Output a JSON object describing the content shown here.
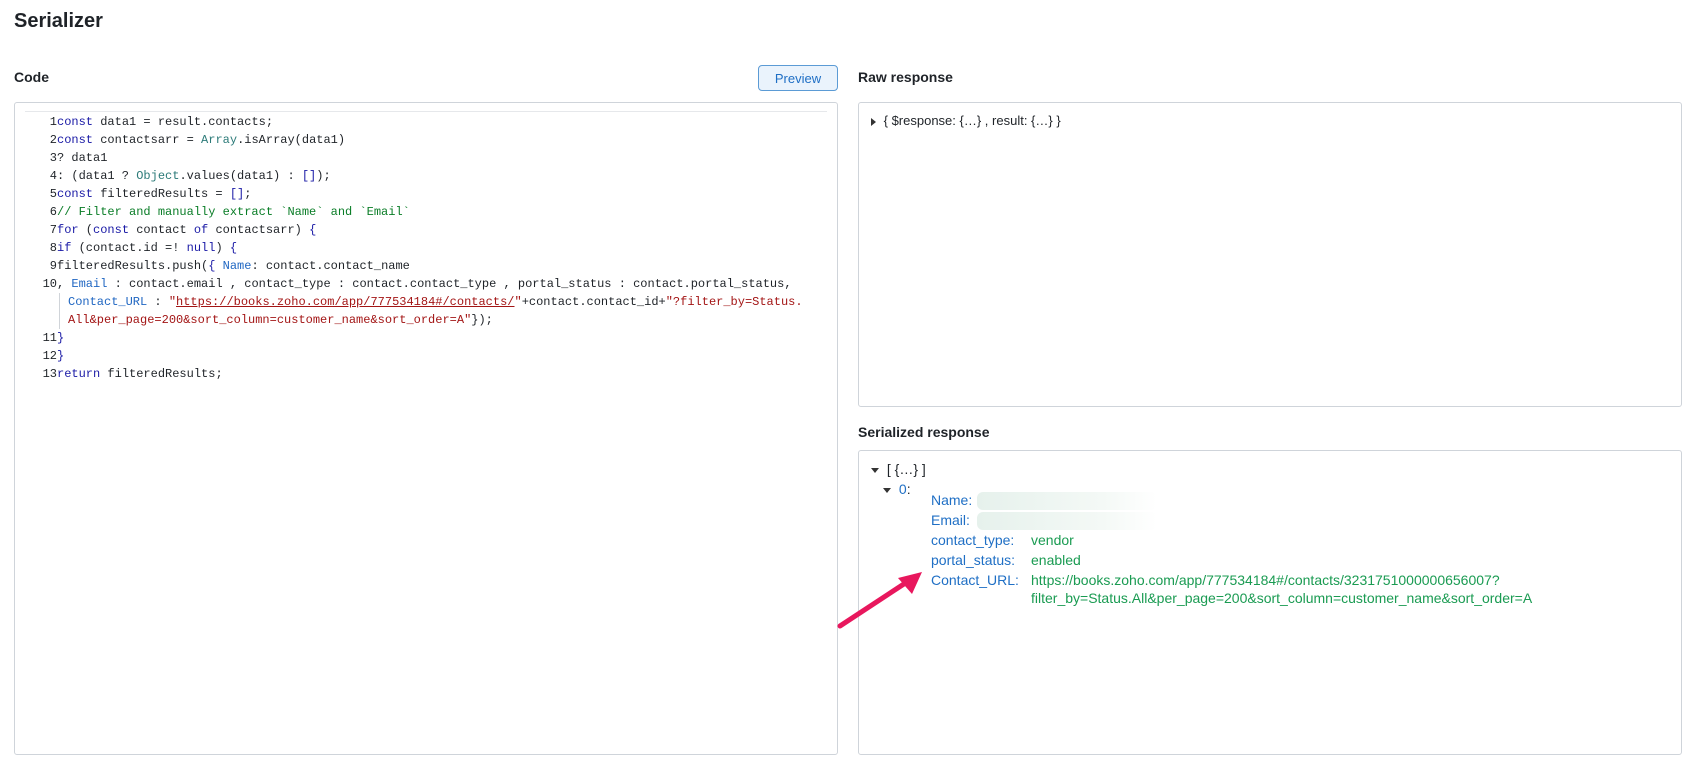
{
  "page": {
    "title": "Serializer"
  },
  "code_panel": {
    "label": "Code",
    "preview_label": "Preview",
    "lines": [
      {
        "n": "1",
        "tokens": [
          {
            "t": "const",
            "c": "kw"
          },
          {
            "t": " data1 = result.contacts;",
            "c": ""
          }
        ]
      },
      {
        "n": "2",
        "tokens": [
          {
            "t": "const",
            "c": "kw"
          },
          {
            "t": " contactsarr = ",
            "c": ""
          },
          {
            "t": "Array",
            "c": "bi"
          },
          {
            "t": ".isArray(data1)",
            "c": ""
          }
        ]
      },
      {
        "n": "3",
        "tokens": [
          {
            "t": "? data1",
            "c": ""
          }
        ]
      },
      {
        "n": "4",
        "tokens": [
          {
            "t": ": (data1 ? ",
            "c": ""
          },
          {
            "t": "Object",
            "c": "bi"
          },
          {
            "t": ".values(data1) : ",
            "c": ""
          },
          {
            "t": "[]",
            "c": "brk"
          },
          {
            "t": ");",
            "c": ""
          }
        ]
      },
      {
        "n": "5",
        "tokens": [
          {
            "t": "const",
            "c": "kw"
          },
          {
            "t": " filteredResults = ",
            "c": ""
          },
          {
            "t": "[]",
            "c": "brk"
          },
          {
            "t": ";",
            "c": ""
          }
        ]
      },
      {
        "n": "6",
        "tokens": [
          {
            "t": "// Filter and manually extract `Name` and `Email`",
            "c": "cm"
          }
        ]
      },
      {
        "n": "7",
        "tokens": [
          {
            "t": "for",
            "c": "kw"
          },
          {
            "t": " (",
            "c": ""
          },
          {
            "t": "const",
            "c": "kw"
          },
          {
            "t": " contact ",
            "c": ""
          },
          {
            "t": "of",
            "c": "kw"
          },
          {
            "t": " contactsarr) ",
            "c": ""
          },
          {
            "t": "{",
            "c": "brk"
          }
        ]
      },
      {
        "n": "8",
        "tokens": [
          {
            "t": "if",
            "c": "kw"
          },
          {
            "t": " (contact.id =! ",
            "c": ""
          },
          {
            "t": "null",
            "c": "kw"
          },
          {
            "t": ") ",
            "c": ""
          },
          {
            "t": "{",
            "c": "brk"
          }
        ]
      },
      {
        "n": "9",
        "tokens": [
          {
            "t": "filteredResults.push(",
            "c": ""
          },
          {
            "t": "{",
            "c": "brk"
          },
          {
            "t": " ",
            "c": ""
          },
          {
            "t": "Name",
            "c": "pr"
          },
          {
            "t": ": contact.contact_name",
            "c": ""
          }
        ]
      },
      {
        "n": "10",
        "tokens": [
          {
            "t": ", ",
            "c": ""
          },
          {
            "t": "Email",
            "c": "pr"
          },
          {
            "t": " : contact.email , contact_type : contact.contact_type , portal_status : contact.portal_status,",
            "c": ""
          }
        ]
      },
      {
        "n": "",
        "cont": true,
        "tokens": [
          {
            "t": "Contact_URL",
            "c": "pr"
          },
          {
            "t": " : ",
            "c": ""
          },
          {
            "t": "\"",
            "c": "str"
          },
          {
            "t": "https://books.zoho.com/app/777534184#/contacts/",
            "c": "url"
          },
          {
            "t": "\"",
            "c": "str"
          },
          {
            "t": "+contact.contact_id+",
            "c": ""
          },
          {
            "t": "\"?filter_by=Status.",
            "c": "str"
          }
        ]
      },
      {
        "n": "",
        "cont": true,
        "tokens": [
          {
            "t": "All&per_page=200&sort_column=customer_name&sort_order=A\"",
            "c": "str"
          },
          {
            "t": "});",
            "c": ""
          }
        ]
      },
      {
        "n": "11",
        "tokens": [
          {
            "t": "}",
            "c": "brk"
          }
        ]
      },
      {
        "n": "12",
        "tokens": [
          {
            "t": "}",
            "c": "brk"
          }
        ]
      },
      {
        "n": "13",
        "tokens": [
          {
            "t": "return",
            "c": "kw"
          },
          {
            "t": " filteredResults;",
            "c": ""
          }
        ]
      }
    ]
  },
  "raw_response": {
    "label": "Raw response",
    "summary": "{ $response: {…} , result: {…} }"
  },
  "serialized_response": {
    "label": "Serialized response",
    "root_summary": "[ {…} ]",
    "item_index": "0",
    "item_colon": ":",
    "properties": [
      {
        "key": "Name:",
        "value": "",
        "blurred": true
      },
      {
        "key": "Email:",
        "value": "",
        "blurred": true
      },
      {
        "key": "contact_type:",
        "value": "vendor"
      },
      {
        "key": "portal_status:",
        "value": "enabled"
      },
      {
        "key": "Contact_URL:",
        "value": "https://books.zoho.com/app/777534184#/contacts/3231751000000656007?filter_by=Status.All&per_page=200&sort_column=customer_name&sort_order=A"
      }
    ]
  },
  "annotation": {
    "arrow_color": "#e8175d"
  }
}
